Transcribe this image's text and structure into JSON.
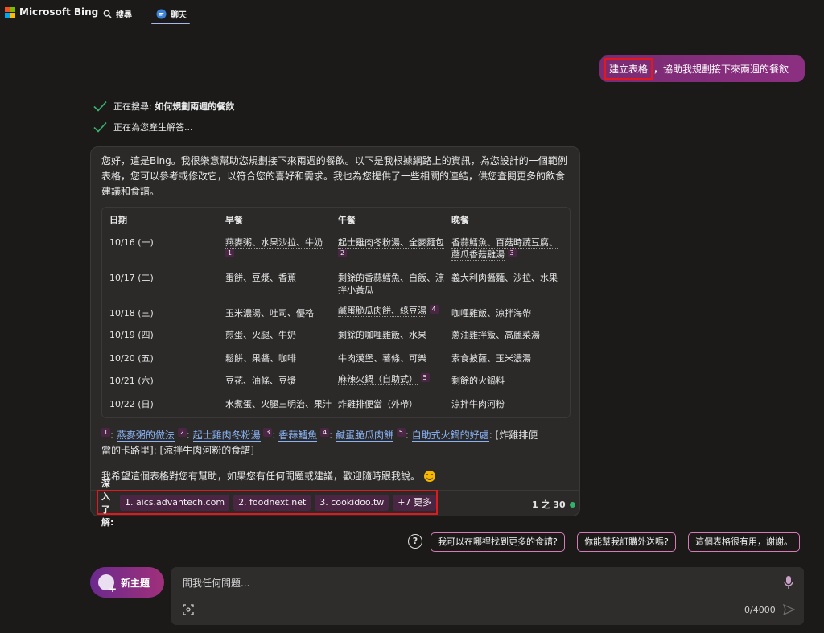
{
  "header": {
    "logo_text": "Microsoft Bing",
    "tabs": [
      {
        "label": "搜尋",
        "icon": "search-icon"
      },
      {
        "label": "聊天",
        "icon": "chat-icon",
        "active": true
      }
    ]
  },
  "user_message": {
    "highlight": "建立表格",
    "rest": "，協助我規劃接下來兩週的餐飲"
  },
  "status": [
    {
      "prefix": "正在搜尋: ",
      "bold": "如何規劃兩週的餐飲"
    },
    {
      "prefix": "正在為您產生解答...",
      "bold": ""
    }
  ],
  "answer": {
    "intro": "您好，這是Bing。我很樂意幫助您規劃接下來兩週的餐飲。以下是我根據網路上的資訊，為您設計的一個範例表格，您可以參考或修改它，以符合您的喜好和需求。我也為您提供了一些相關的連結，供您查閱更多的飲食建議和食譜。",
    "table": {
      "headers": [
        "日期",
        "早餐",
        "午餐",
        "晚餐"
      ],
      "rows": [
        {
          "date": "10/16 (一)",
          "breakfast": "燕麥粥、水果沙拉、牛奶",
          "lunch": "起士雞肉冬粉湯、全麥麵包",
          "dinner_1": "香蒜鱈魚、百菇時蔬豆腐、",
          "dinner_2": "蘑瓜香菇雞湯",
          "b_ref": "1",
          "l_ref": "2",
          "d_ref": "3"
        },
        {
          "date": "10/17 (二)",
          "breakfast": "蛋餅、豆漿、香蕉",
          "lunch_1": "剩餘的香蒜鱈魚、白飯、涼",
          "lunch_2": "拌小黃瓜",
          "dinner": "義大利肉醬麵、沙拉、水果"
        },
        {
          "date": "10/18 (三)",
          "breakfast": "玉米濃湯、吐司、優格",
          "lunch": "鹹蛋脆瓜肉餅、綠豆湯",
          "dinner": "咖哩雞飯、涼拌海帶",
          "l_ref": "4"
        },
        {
          "date": "10/19 (四)",
          "breakfast": "煎蛋、火腿、牛奶",
          "lunch": "剩餘的咖哩雞飯、水果",
          "dinner": "蔥油雞拌飯、高麗菜湯"
        },
        {
          "date": "10/20 (五)",
          "breakfast": "鬆餅、果醬、咖啡",
          "lunch": "牛肉漢堡、薯條、可樂",
          "dinner": "素食披薩、玉米濃湯"
        },
        {
          "date": "10/21 (六)",
          "breakfast": "豆花、油條、豆漿",
          "lunch": "麻辣火鍋（自助式）",
          "dinner": "剩餘的火鍋料",
          "l_ref": "5"
        },
        {
          "date": "10/22 (日)",
          "breakfast": "水煮蛋、火腿三明治、果汁",
          "lunch": "炸雞排便當（外帶）",
          "dinner": "涼拌牛肉河粉"
        }
      ]
    },
    "refs": [
      {
        "num": "1",
        "text": "燕麥粥的做法"
      },
      {
        "num": "2",
        "text": "起士雞肉冬粉湯"
      },
      {
        "num": "3",
        "text": "香蒜鱈魚"
      },
      {
        "num": "4",
        "text": "鹹蛋脆瓜肉餅"
      },
      {
        "num": "5",
        "text": "自助式火鍋的好處"
      }
    ],
    "refs_tail_1": ": [炸雞排便",
    "refs_tail_2": "當的卡路里]: [涼拌牛肉河粉的食譜]",
    "closing": "我希望這個表格對您有幫助，如果您有任何問題或建議，歡迎隨時跟我說。",
    "learn_more": {
      "label": "深入了解:",
      "links": [
        "1. aics.advantech.com",
        "2. foodnext.net",
        "3. cookidoo.tw",
        "+7 更多"
      ]
    },
    "counter": "1 之 30",
    "counter_color": "#2fb36b"
  },
  "suggestions": [
    "我可以在哪裡找到更多的食譜?",
    "你能幫我訂購外送嗎?",
    "這個表格很有用，謝謝。"
  ],
  "new_topic_label": "新主題",
  "input": {
    "placeholder": "問我任何問題...",
    "char_count": "0/4000"
  }
}
